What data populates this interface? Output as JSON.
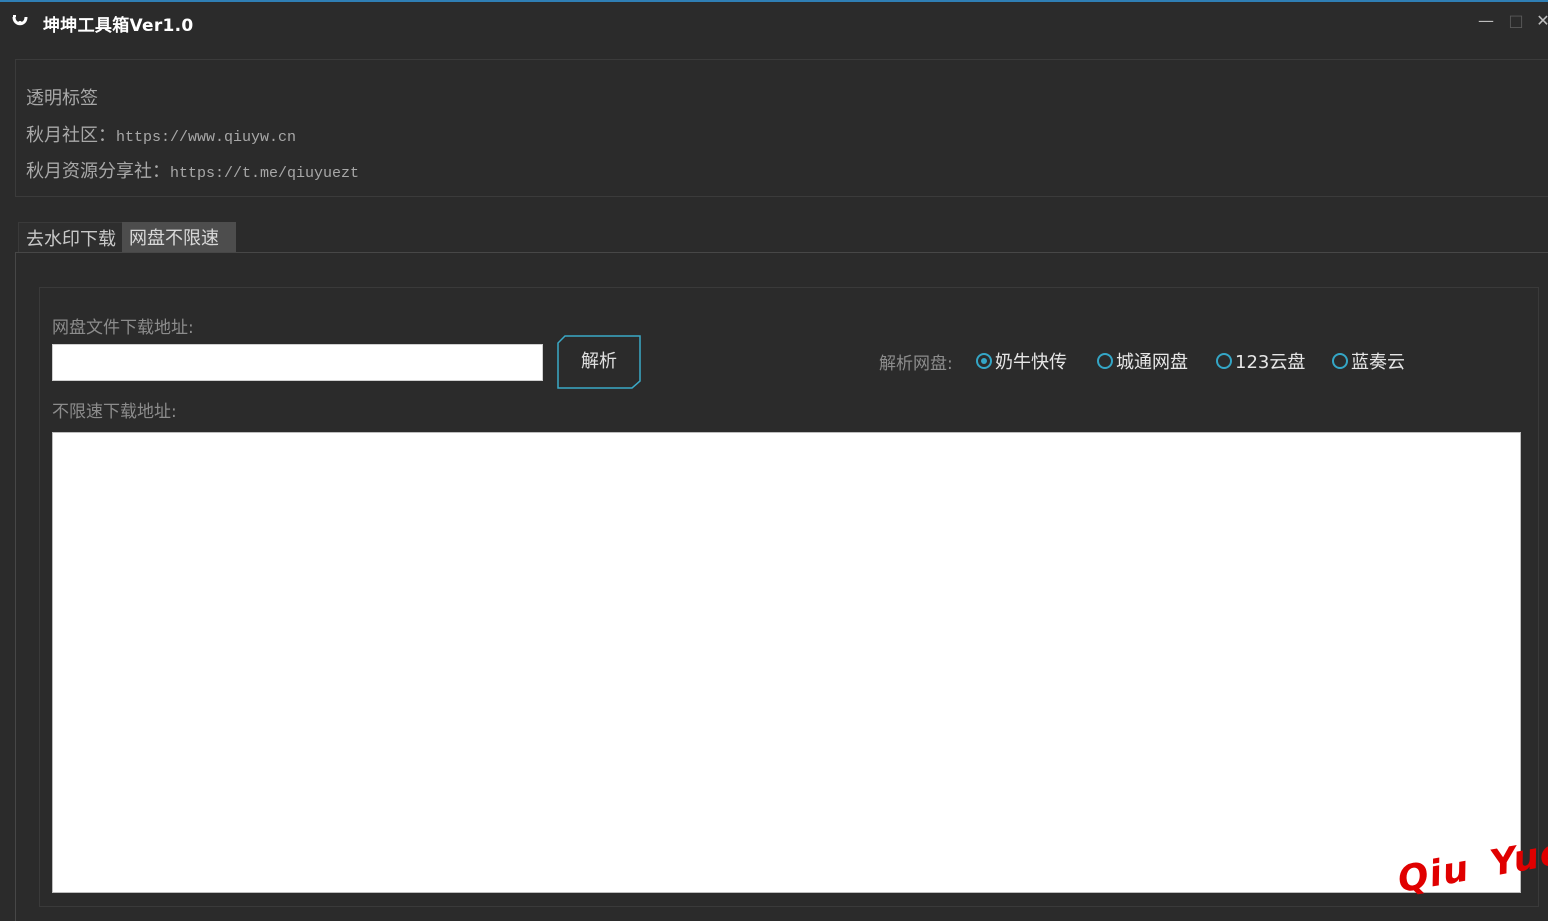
{
  "window": {
    "title": "坤坤工具箱Ver1.0",
    "minimize_glyph": "—",
    "maximize_glyph": "□",
    "close_glyph": "✕"
  },
  "info": {
    "line1": "透明标签",
    "line2_label": "秋月社区：",
    "line2_url": "https://www.qiuyw.cn",
    "line3_label": "秋月资源分享社：",
    "line3_url": "https://t.me/qiuyuezt"
  },
  "tabs": [
    {
      "label": "去水印下载",
      "selected": false
    },
    {
      "label": "网盘不限速",
      "selected": true
    }
  ],
  "form": {
    "url_label": "网盘文件下载地址:",
    "url_value": "",
    "parse_button": "解析",
    "disk_label": "解析网盘:",
    "disks": [
      {
        "label": "奶牛快传",
        "checked": true
      },
      {
        "label": "城通网盘",
        "checked": false
      },
      {
        "label": "123云盘",
        "checked": false
      },
      {
        "label": "蓝奏云",
        "checked": false
      }
    ],
    "output_label": "不限速下载地址:",
    "output_value": ""
  },
  "watermark": {
    "word1": "Qiu",
    "word2": "Yue"
  },
  "colors": {
    "background": "#2b2b2b",
    "accent": "#34a6c6",
    "title_border": "#2f7fb5",
    "watermark": "#e00000"
  }
}
